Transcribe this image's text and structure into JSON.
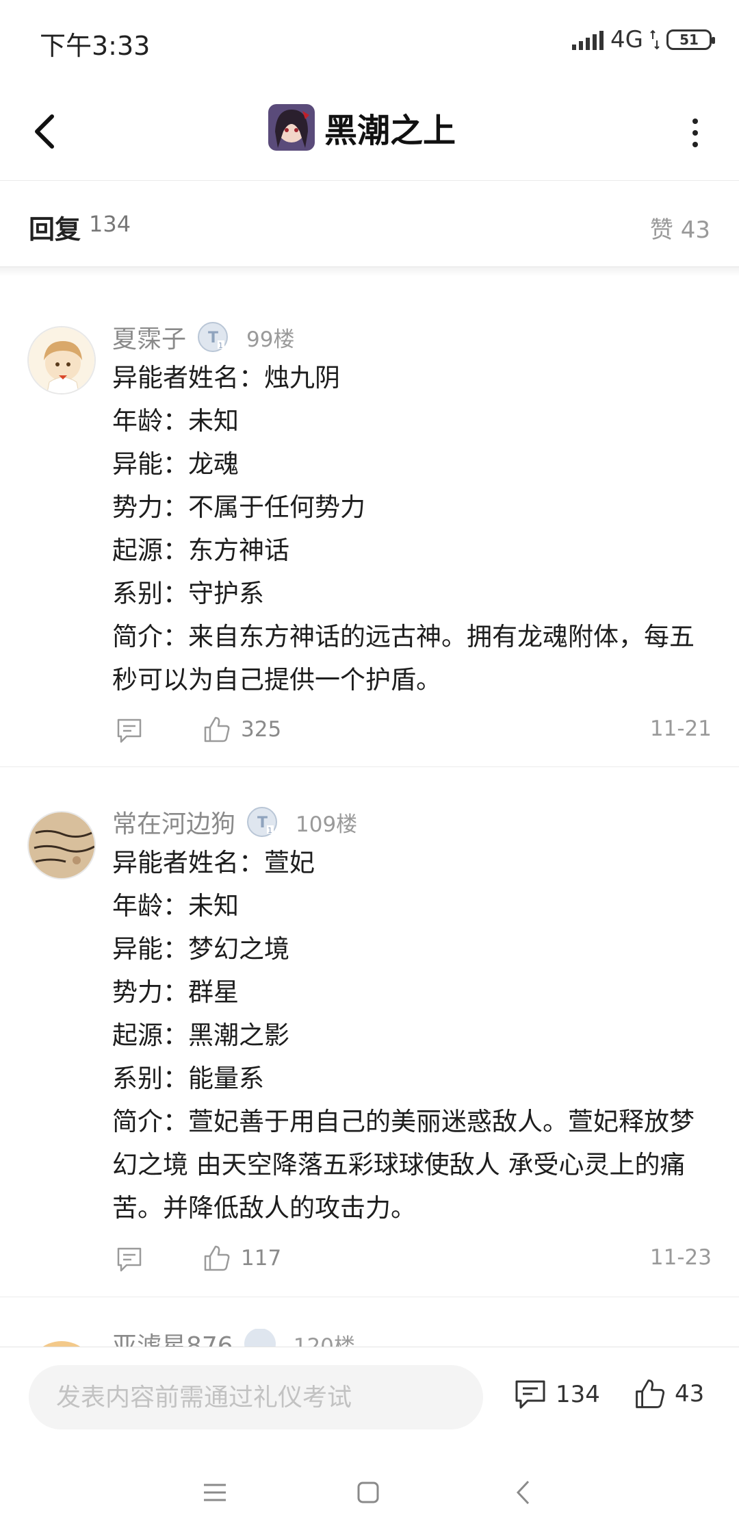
{
  "status_bar": {
    "time": "下午3:33",
    "network": "4G",
    "battery": "51"
  },
  "nav": {
    "title": "黑潮之上"
  },
  "reply_header": {
    "reply_label": "回复",
    "reply_count": "134",
    "like_label": "赞 43"
  },
  "posts": [
    {
      "username": "夏霂子",
      "floor": "99楼",
      "lines": [
        "异能者姓名：烛九阴",
        "年龄：未知",
        "异能：龙魂",
        "势力：不属于任何势力",
        "起源：东方神话",
        "系别：守护系",
        "简介：来自东方神话的远古神。拥有龙魂附体，每五秒可以为自己提供一个护盾。"
      ],
      "likes": "325",
      "date": "11-21"
    },
    {
      "username": "常在河边狗",
      "floor": "109楼",
      "lines": [
        "异能者姓名：萱妃",
        "年龄：未知",
        "异能：梦幻之境",
        "势力：群星",
        "起源：黑潮之影",
        "系别：能量系",
        "简介：萱妃善于用自己的美丽迷惑敌人。萱妃释放梦幻之境 由天空降落五彩球球使敌人 承受心灵上的痛苦。并降低敌人的攻击力。"
      ],
      "likes": "117",
      "date": "11-23"
    }
  ],
  "partial_post": {
    "username": "亚滤星876",
    "floor": "120楼"
  },
  "bottom_bar": {
    "input_placeholder": "发表内容前需通过礼仪考试",
    "comment_count": "134",
    "like_count": "43"
  },
  "colors": {
    "text": "#1d1d1d",
    "muted": "#8a8a8a",
    "divider": "#ececec",
    "input_bg": "#f4f4f4"
  }
}
